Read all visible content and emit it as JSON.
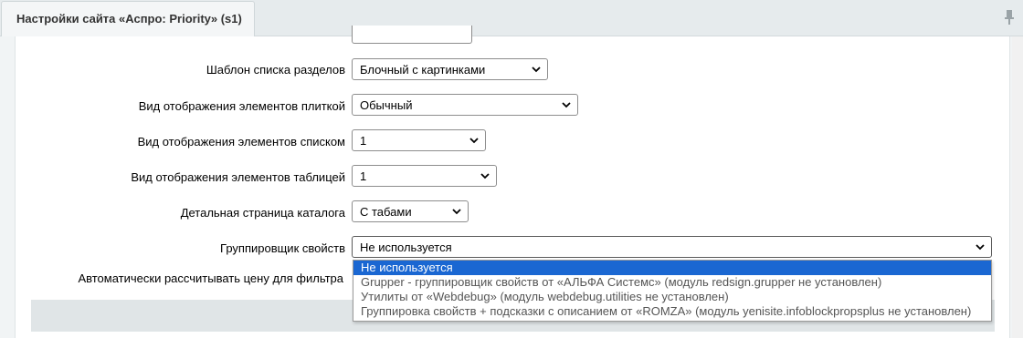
{
  "window": {
    "tab_title": "Настройки сайта «Аспро: Priority» (s1)",
    "pin_icon": "pin-icon"
  },
  "form": {
    "rows": [
      {
        "label": "Шаблон списка разделов",
        "value": "Блочный с картинками"
      },
      {
        "label": "Вид отображения элементов плиткой",
        "value": "Обычный"
      },
      {
        "label": "Вид отображения элементов списком",
        "value": "1"
      },
      {
        "label": "Вид отображения элементов таблицей",
        "value": "1"
      },
      {
        "label": "Детальная страница каталога",
        "value": "С табами"
      },
      {
        "label": "Группировщик свойств",
        "value": "Не используется"
      },
      {
        "label": "Автоматически рассчитывать цену для фильтра",
        "value": ""
      }
    ]
  },
  "dropdown": {
    "options": [
      "Не используется",
      "Grupper - группировщик свойств от «АЛЬФА Системс» (модуль redsign.grupper не установлен)",
      "Утилиты от «Webdebug» (модуль webdebug.utilities не установлен)",
      "Группировка свойств + подсказки с описанием от «ROMZA» (модуль yenisite.infoblockpropsplus не установлен)"
    ],
    "selected_index": 0
  },
  "colors": {
    "selected_option_bg": "#1a67d2",
    "tabbar_bg": "#e6ebed"
  }
}
